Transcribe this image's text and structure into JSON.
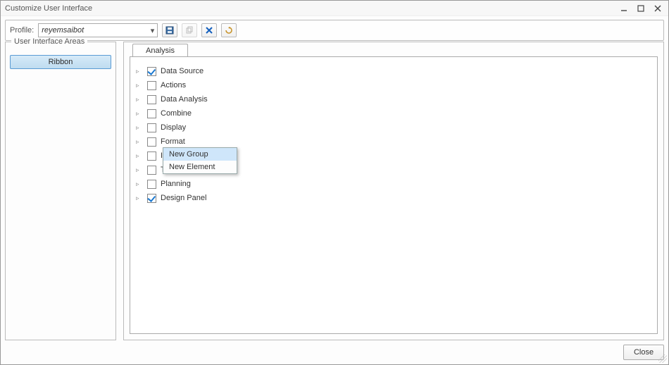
{
  "window": {
    "title": "Customize User Interface"
  },
  "toolbar": {
    "profile_label": "Profile:",
    "profile_value": "reyemsaibot"
  },
  "left": {
    "group_title": "User Interface Areas",
    "ribbon_label": "Ribbon"
  },
  "tabs": {
    "active": "Analysis"
  },
  "tree": {
    "items": [
      {
        "label": "Data Source",
        "checked": true
      },
      {
        "label": "Actions",
        "checked": false
      },
      {
        "label": "Data Analysis",
        "checked": false
      },
      {
        "label": "Combine",
        "checked": false
      },
      {
        "label": "Display",
        "checked": false
      },
      {
        "label": "Format",
        "checked": false
      },
      {
        "label": "Insert Component",
        "checked": false
      },
      {
        "label": "Tools",
        "checked": false
      },
      {
        "label": "Planning",
        "checked": false
      },
      {
        "label": "Design Panel",
        "checked": true
      }
    ]
  },
  "context_menu": {
    "items": [
      "New Group",
      "New Element"
    ]
  },
  "footer": {
    "close_label": "Close"
  }
}
